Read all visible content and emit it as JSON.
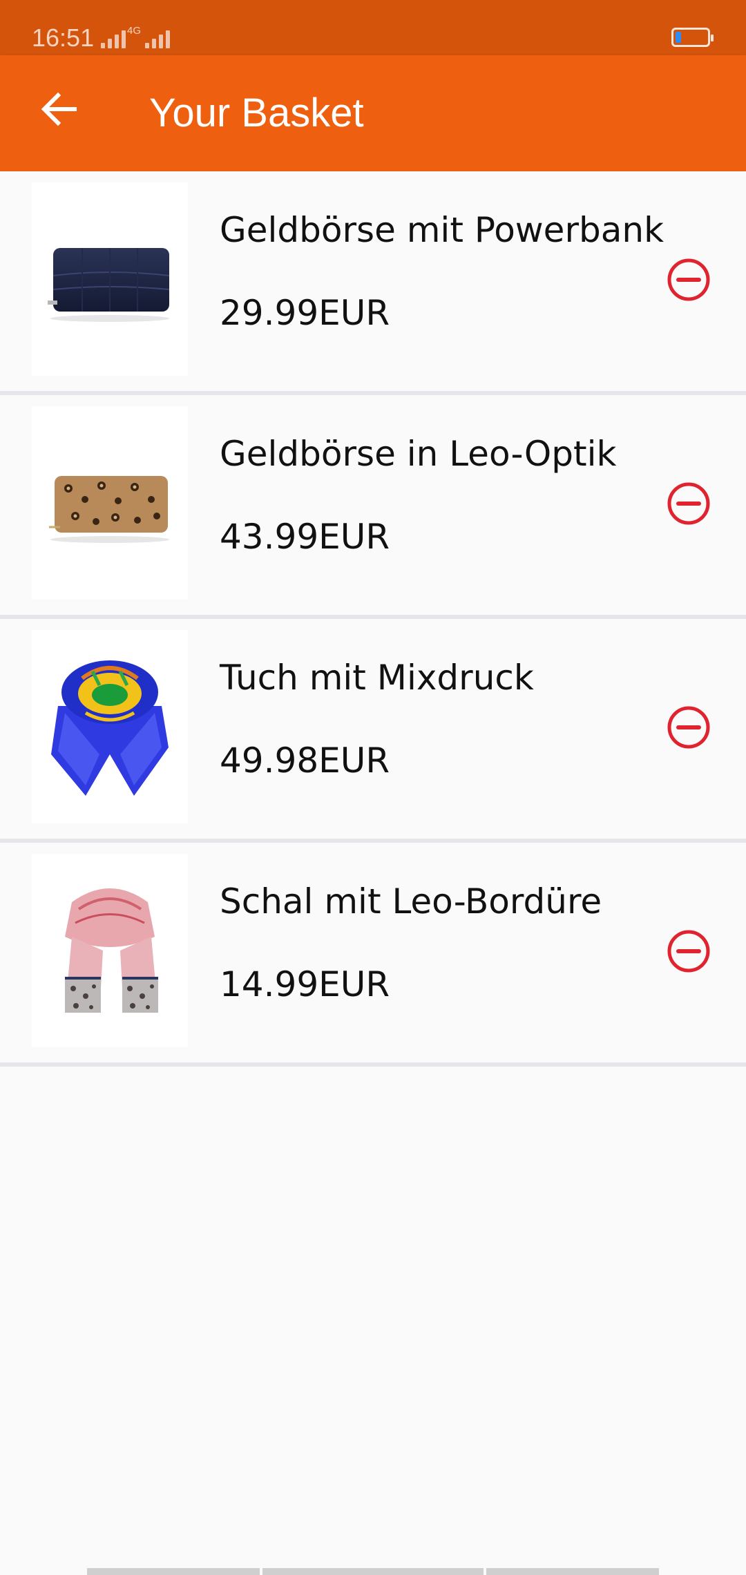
{
  "status_bar": {
    "time": "16:51",
    "network": "4G"
  },
  "app_bar": {
    "title": "Your Basket",
    "back_icon": "arrow-back-icon"
  },
  "basket": {
    "items": [
      {
        "name": "Geldbörse mit Powerbank",
        "price": "29.99EUR",
        "image_icon": "navy-wallet-icon"
      },
      {
        "name": "Geldbörse in Leo-Optik",
        "price": "43.99EUR",
        "image_icon": "leopard-wallet-icon"
      },
      {
        "name": "Tuch mit Mixdruck",
        "price": "49.98EUR",
        "image_icon": "blue-scarf-icon"
      },
      {
        "name": "Schal mit Leo-Bordüre",
        "price": "14.99EUR",
        "image_icon": "pink-scarf-icon"
      }
    ],
    "remove_icon": "minus-circle-icon"
  },
  "colors": {
    "accent": "#ee5f10",
    "status_bar": "#d4540c",
    "remove": "#e0242f"
  }
}
